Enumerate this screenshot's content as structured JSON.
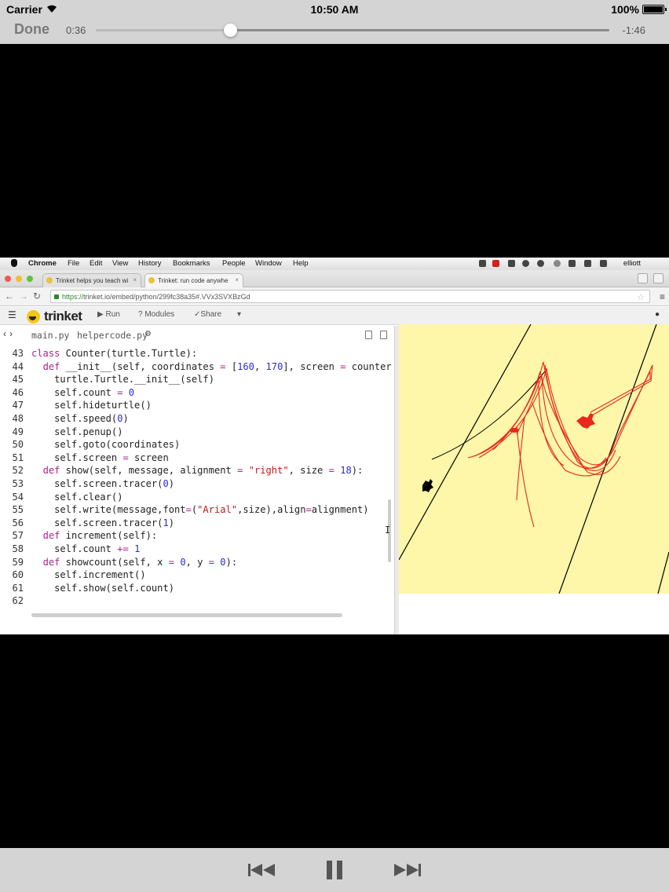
{
  "status": {
    "carrier": "Carrier",
    "time": "10:50 AM",
    "battery": "100%"
  },
  "player": {
    "done_label": "Done",
    "elapsed": "0:36",
    "remaining": "-1:46",
    "progress": 0.262
  },
  "menubar": {
    "items": [
      "Chrome",
      "File",
      "Edit",
      "View",
      "History",
      "Bookmarks",
      "People",
      "Window",
      "Help"
    ],
    "user": "elliott"
  },
  "browser": {
    "tabs": [
      "Trinket helps you teach wi",
      "Trinket: run code anywhe"
    ],
    "url_scheme": "https://",
    "url_rest": "trinket.io/embed/python/299fc38a35#.VVx3SVXBzGd"
  },
  "trinket": {
    "brand": "trinket",
    "run_label": "Run",
    "modules_label": "Modules",
    "share_label": "Share"
  },
  "files": {
    "main": "main.py",
    "helper": "helpercode.py"
  },
  "code": [
    {
      "n": "43",
      "t": "class Counter(turtle.Turtle):"
    },
    {
      "n": "44",
      "t": "  def __init__(self, coordinates = [160, 170], screen = counter"
    },
    {
      "n": "45",
      "t": "    turtle.Turtle.__init__(self)"
    },
    {
      "n": "46",
      "t": "    self.count = 0"
    },
    {
      "n": "47",
      "t": "    self.hideturtle()"
    },
    {
      "n": "48",
      "t": "    self.speed(0)"
    },
    {
      "n": "49",
      "t": "    self.penup()"
    },
    {
      "n": "50",
      "t": "    self.goto(coordinates)"
    },
    {
      "n": "51",
      "t": "    self.screen = screen"
    },
    {
      "n": "52",
      "t": "  def show(self, message, alignment = \"right\", size = 18):"
    },
    {
      "n": "53",
      "t": "    self.screen.tracer(0)"
    },
    {
      "n": "54",
      "t": "    self.clear()"
    },
    {
      "n": "55",
      "t": "    self.write(message,font=(\"Arial\",size),align=alignment)"
    },
    {
      "n": "56",
      "t": "    self.screen.tracer(1)"
    },
    {
      "n": "57",
      "t": "  def increment(self):"
    },
    {
      "n": "58",
      "t": "    self.count += 1"
    },
    {
      "n": "59",
      "t": "  def showcount(self, x = 0, y = 0):"
    },
    {
      "n": "60",
      "t": "    self.increment()"
    },
    {
      "n": "61",
      "t": "    self.show(self.count)"
    },
    {
      "n": "62",
      "t": ""
    }
  ],
  "colors": {
    "ios_bar": "#d4d4d4",
    "output_bg": "#fef6a9",
    "turtle_red": "#e8281e",
    "keyword": "#b0238a",
    "number": "#2b2bd6",
    "string": "#c01a1a"
  },
  "controls": {
    "prev_icon": "rewind-icon",
    "pause_icon": "pause-icon",
    "next_icon": "fast-forward-icon"
  }
}
